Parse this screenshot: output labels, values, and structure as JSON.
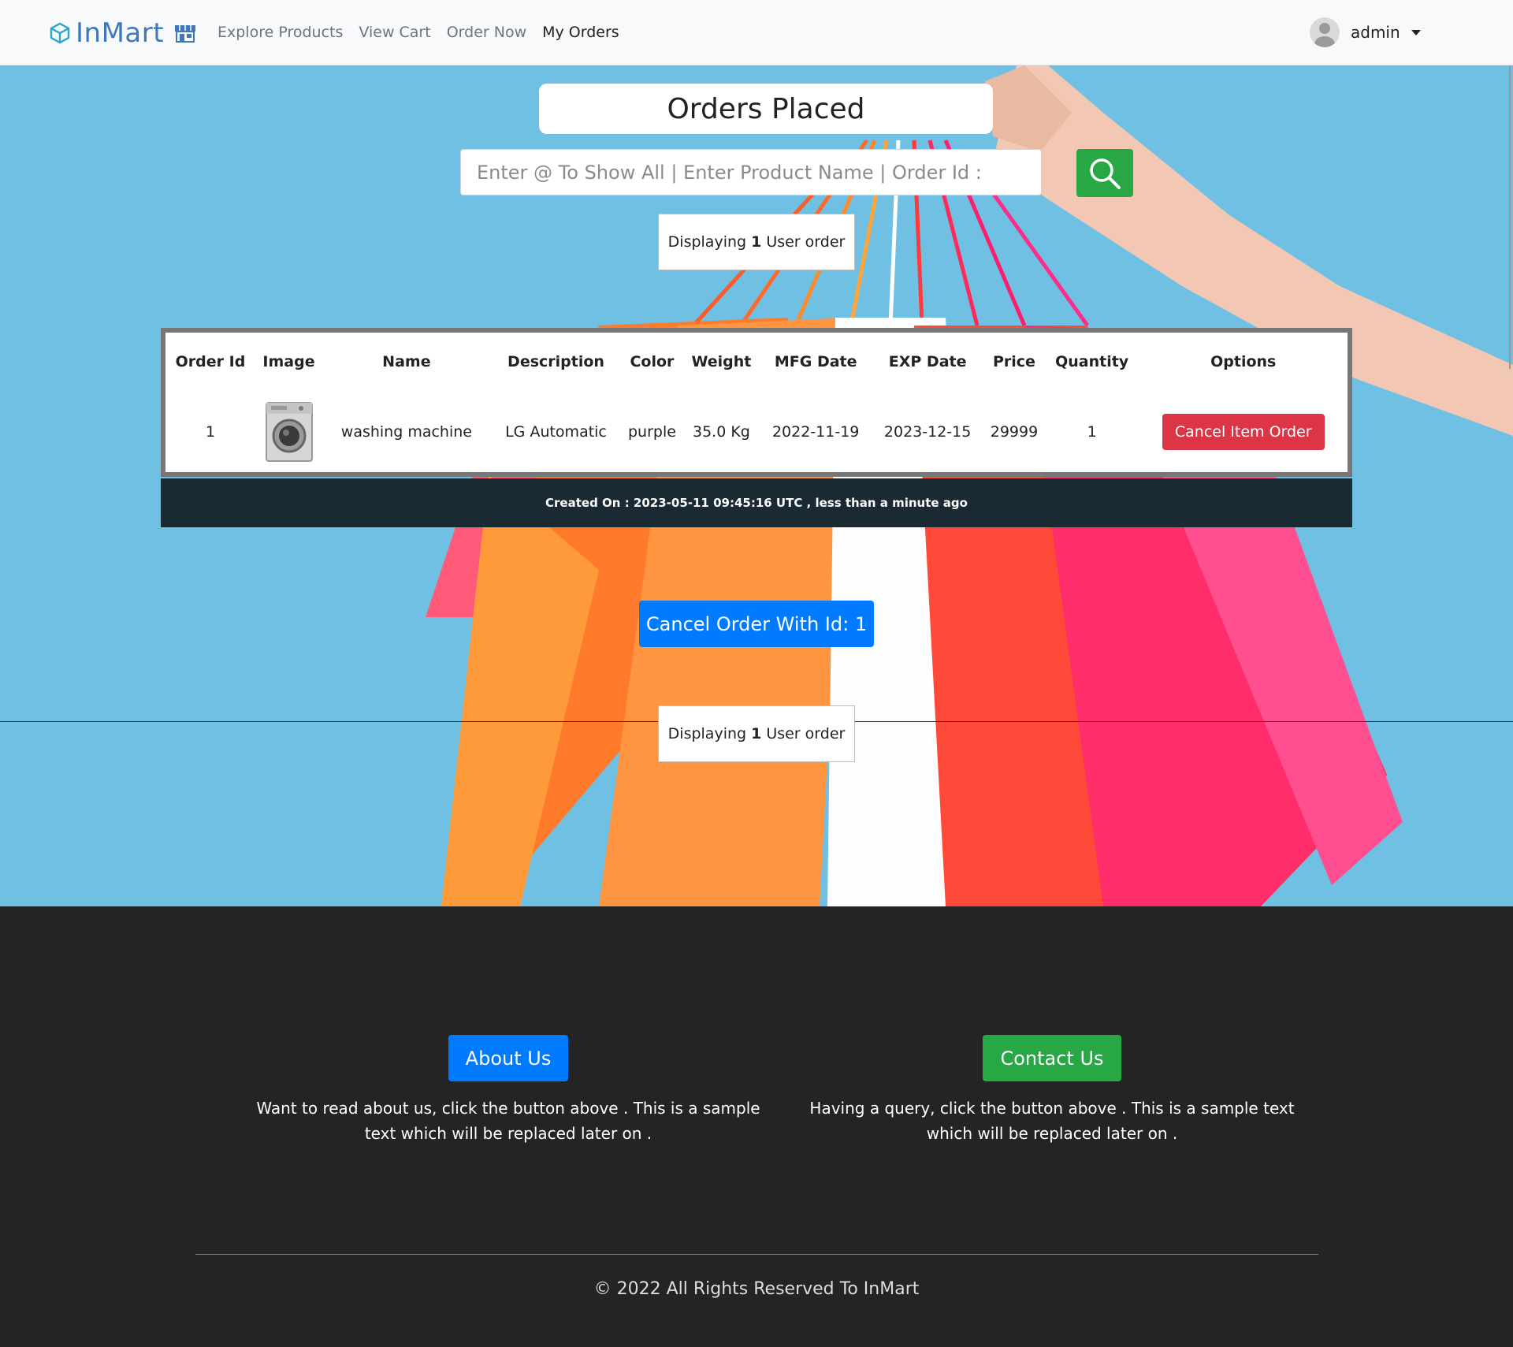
{
  "navbar": {
    "brand": "InMart",
    "links": [
      "Explore Products",
      "View Cart",
      "Order Now",
      "My Orders"
    ],
    "active_link": "My Orders",
    "user": "admin"
  },
  "main": {
    "title": "Orders Placed",
    "search_placeholder": "Enter @ To Show All | Enter Product Name | Order Id :",
    "count_prefix": "Displaying",
    "count_value": "1",
    "count_suffix": "User order",
    "table": {
      "headers": [
        "Order Id",
        "Image",
        "Name",
        "Description",
        "Color",
        "Weight",
        "MFG Date",
        "EXP Date",
        "Price",
        "Quantity",
        "Options"
      ],
      "row": {
        "order_id": "1",
        "name": "washing machine",
        "description": "LG Automatic",
        "color": "purple",
        "weight": "35.0 Kg",
        "mfg_date": "2022-11-19",
        "exp_date": "2023-12-15",
        "price": "29999",
        "quantity": "1",
        "cancel_label": "Cancel Item Order"
      }
    },
    "created_on": "Created On : 2023-05-11 09:45:16 UTC , less than a minute ago",
    "cancel_order_label": "Cancel Order With Id: 1"
  },
  "footer": {
    "about_label": "About Us",
    "about_text": "Want to read about us, click the button above . This is a sample text which will be replaced later on .",
    "contact_label": "Contact Us",
    "contact_text": "Having a query, click the button above . This is a sample text which will be replaced later on .",
    "copyright": "© 2022 All Rights Reserved To InMart"
  },
  "colors": {
    "hero_bg": "#6fc0e3",
    "search_button": "#28a745",
    "danger": "#dc3545",
    "primary": "#007bff",
    "footer_bg": "#242426"
  },
  "icons": {
    "brand": "cube-icon",
    "store": "store-icon",
    "search": "search-icon",
    "user": "avatar-icon",
    "dropdown": "caret-down-icon"
  }
}
